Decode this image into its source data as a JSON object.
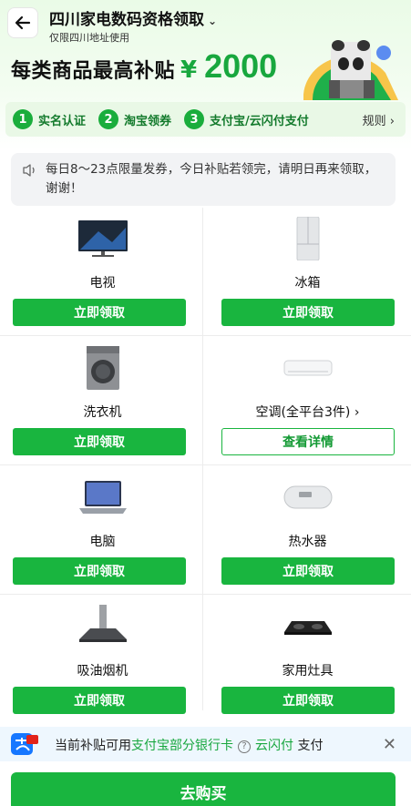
{
  "header": {
    "title": "四川家电数码资格领取",
    "title_chevron": "⌄",
    "subtitle": "仅限四川地址使用"
  },
  "promo": {
    "text": "每类商品最高补贴",
    "currency": "¥",
    "amount": "2000"
  },
  "steps": [
    {
      "num": "1",
      "label": "实名认证"
    },
    {
      "num": "2",
      "label": "淘宝领券"
    },
    {
      "num": "3",
      "label": "支付宝/云闪付支付"
    }
  ],
  "rules_label": "规则 ›",
  "notice": {
    "text": "每日8～23点限量发券，今日补贴若领完，请明日再来领取，谢谢！"
  },
  "products": [
    {
      "name": "电视",
      "button": "立即领取",
      "icon": "tv-icon"
    },
    {
      "name": "冰箱",
      "button": "立即领取",
      "icon": "fridge-icon"
    },
    {
      "name": "洗衣机",
      "button": "立即领取",
      "icon": "washer-icon"
    },
    {
      "name": "空调(全平台3件) ›",
      "button": "查看详情",
      "icon": "air-conditioner-icon"
    },
    {
      "name": "电脑",
      "button": "立即领取",
      "icon": "laptop-icon"
    },
    {
      "name": "热水器",
      "button": "立即领取",
      "icon": "water-heater-icon"
    },
    {
      "name": "吸油烟机",
      "button": "立即领取",
      "icon": "range-hood-icon"
    },
    {
      "name": "家用灶具",
      "button": "立即领取",
      "icon": "stove-icon"
    }
  ],
  "footer": {
    "prefix": "当前补贴可用",
    "highlight1": "支付宝部分银行卡",
    "help": "?",
    "highlight2": "云闪付",
    "suffix": "支付",
    "close": "✕"
  },
  "buy_button": "去购买",
  "colors": {
    "accent": "#19b53f",
    "accent_text": "#18a73e",
    "notice_bg": "#f2f3f5",
    "footer_bg": "#eef7fe"
  }
}
